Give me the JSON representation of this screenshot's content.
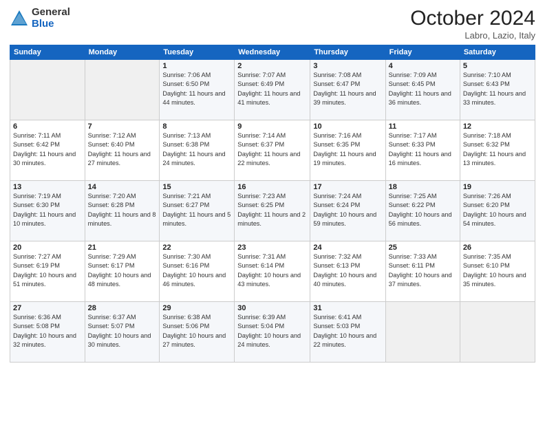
{
  "header": {
    "logo_general": "General",
    "logo_blue": "Blue",
    "month": "October 2024",
    "location": "Labro, Lazio, Italy"
  },
  "weekdays": [
    "Sunday",
    "Monday",
    "Tuesday",
    "Wednesday",
    "Thursday",
    "Friday",
    "Saturday"
  ],
  "weeks": [
    [
      {
        "day": "",
        "info": ""
      },
      {
        "day": "",
        "info": ""
      },
      {
        "day": "1",
        "info": "Sunrise: 7:06 AM\nSunset: 6:50 PM\nDaylight: 11 hours and 44 minutes."
      },
      {
        "day": "2",
        "info": "Sunrise: 7:07 AM\nSunset: 6:49 PM\nDaylight: 11 hours and 41 minutes."
      },
      {
        "day": "3",
        "info": "Sunrise: 7:08 AM\nSunset: 6:47 PM\nDaylight: 11 hours and 39 minutes."
      },
      {
        "day": "4",
        "info": "Sunrise: 7:09 AM\nSunset: 6:45 PM\nDaylight: 11 hours and 36 minutes."
      },
      {
        "day": "5",
        "info": "Sunrise: 7:10 AM\nSunset: 6:43 PM\nDaylight: 11 hours and 33 minutes."
      }
    ],
    [
      {
        "day": "6",
        "info": "Sunrise: 7:11 AM\nSunset: 6:42 PM\nDaylight: 11 hours and 30 minutes."
      },
      {
        "day": "7",
        "info": "Sunrise: 7:12 AM\nSunset: 6:40 PM\nDaylight: 11 hours and 27 minutes."
      },
      {
        "day": "8",
        "info": "Sunrise: 7:13 AM\nSunset: 6:38 PM\nDaylight: 11 hours and 24 minutes."
      },
      {
        "day": "9",
        "info": "Sunrise: 7:14 AM\nSunset: 6:37 PM\nDaylight: 11 hours and 22 minutes."
      },
      {
        "day": "10",
        "info": "Sunrise: 7:16 AM\nSunset: 6:35 PM\nDaylight: 11 hours and 19 minutes."
      },
      {
        "day": "11",
        "info": "Sunrise: 7:17 AM\nSunset: 6:33 PM\nDaylight: 11 hours and 16 minutes."
      },
      {
        "day": "12",
        "info": "Sunrise: 7:18 AM\nSunset: 6:32 PM\nDaylight: 11 hours and 13 minutes."
      }
    ],
    [
      {
        "day": "13",
        "info": "Sunrise: 7:19 AM\nSunset: 6:30 PM\nDaylight: 11 hours and 10 minutes."
      },
      {
        "day": "14",
        "info": "Sunrise: 7:20 AM\nSunset: 6:28 PM\nDaylight: 11 hours and 8 minutes."
      },
      {
        "day": "15",
        "info": "Sunrise: 7:21 AM\nSunset: 6:27 PM\nDaylight: 11 hours and 5 minutes."
      },
      {
        "day": "16",
        "info": "Sunrise: 7:23 AM\nSunset: 6:25 PM\nDaylight: 11 hours and 2 minutes."
      },
      {
        "day": "17",
        "info": "Sunrise: 7:24 AM\nSunset: 6:24 PM\nDaylight: 10 hours and 59 minutes."
      },
      {
        "day": "18",
        "info": "Sunrise: 7:25 AM\nSunset: 6:22 PM\nDaylight: 10 hours and 56 minutes."
      },
      {
        "day": "19",
        "info": "Sunrise: 7:26 AM\nSunset: 6:20 PM\nDaylight: 10 hours and 54 minutes."
      }
    ],
    [
      {
        "day": "20",
        "info": "Sunrise: 7:27 AM\nSunset: 6:19 PM\nDaylight: 10 hours and 51 minutes."
      },
      {
        "day": "21",
        "info": "Sunrise: 7:29 AM\nSunset: 6:17 PM\nDaylight: 10 hours and 48 minutes."
      },
      {
        "day": "22",
        "info": "Sunrise: 7:30 AM\nSunset: 6:16 PM\nDaylight: 10 hours and 46 minutes."
      },
      {
        "day": "23",
        "info": "Sunrise: 7:31 AM\nSunset: 6:14 PM\nDaylight: 10 hours and 43 minutes."
      },
      {
        "day": "24",
        "info": "Sunrise: 7:32 AM\nSunset: 6:13 PM\nDaylight: 10 hours and 40 minutes."
      },
      {
        "day": "25",
        "info": "Sunrise: 7:33 AM\nSunset: 6:11 PM\nDaylight: 10 hours and 37 minutes."
      },
      {
        "day": "26",
        "info": "Sunrise: 7:35 AM\nSunset: 6:10 PM\nDaylight: 10 hours and 35 minutes."
      }
    ],
    [
      {
        "day": "27",
        "info": "Sunrise: 6:36 AM\nSunset: 5:08 PM\nDaylight: 10 hours and 32 minutes."
      },
      {
        "day": "28",
        "info": "Sunrise: 6:37 AM\nSunset: 5:07 PM\nDaylight: 10 hours and 30 minutes."
      },
      {
        "day": "29",
        "info": "Sunrise: 6:38 AM\nSunset: 5:06 PM\nDaylight: 10 hours and 27 minutes."
      },
      {
        "day": "30",
        "info": "Sunrise: 6:39 AM\nSunset: 5:04 PM\nDaylight: 10 hours and 24 minutes."
      },
      {
        "day": "31",
        "info": "Sunrise: 6:41 AM\nSunset: 5:03 PM\nDaylight: 10 hours and 22 minutes."
      },
      {
        "day": "",
        "info": ""
      },
      {
        "day": "",
        "info": ""
      }
    ]
  ]
}
